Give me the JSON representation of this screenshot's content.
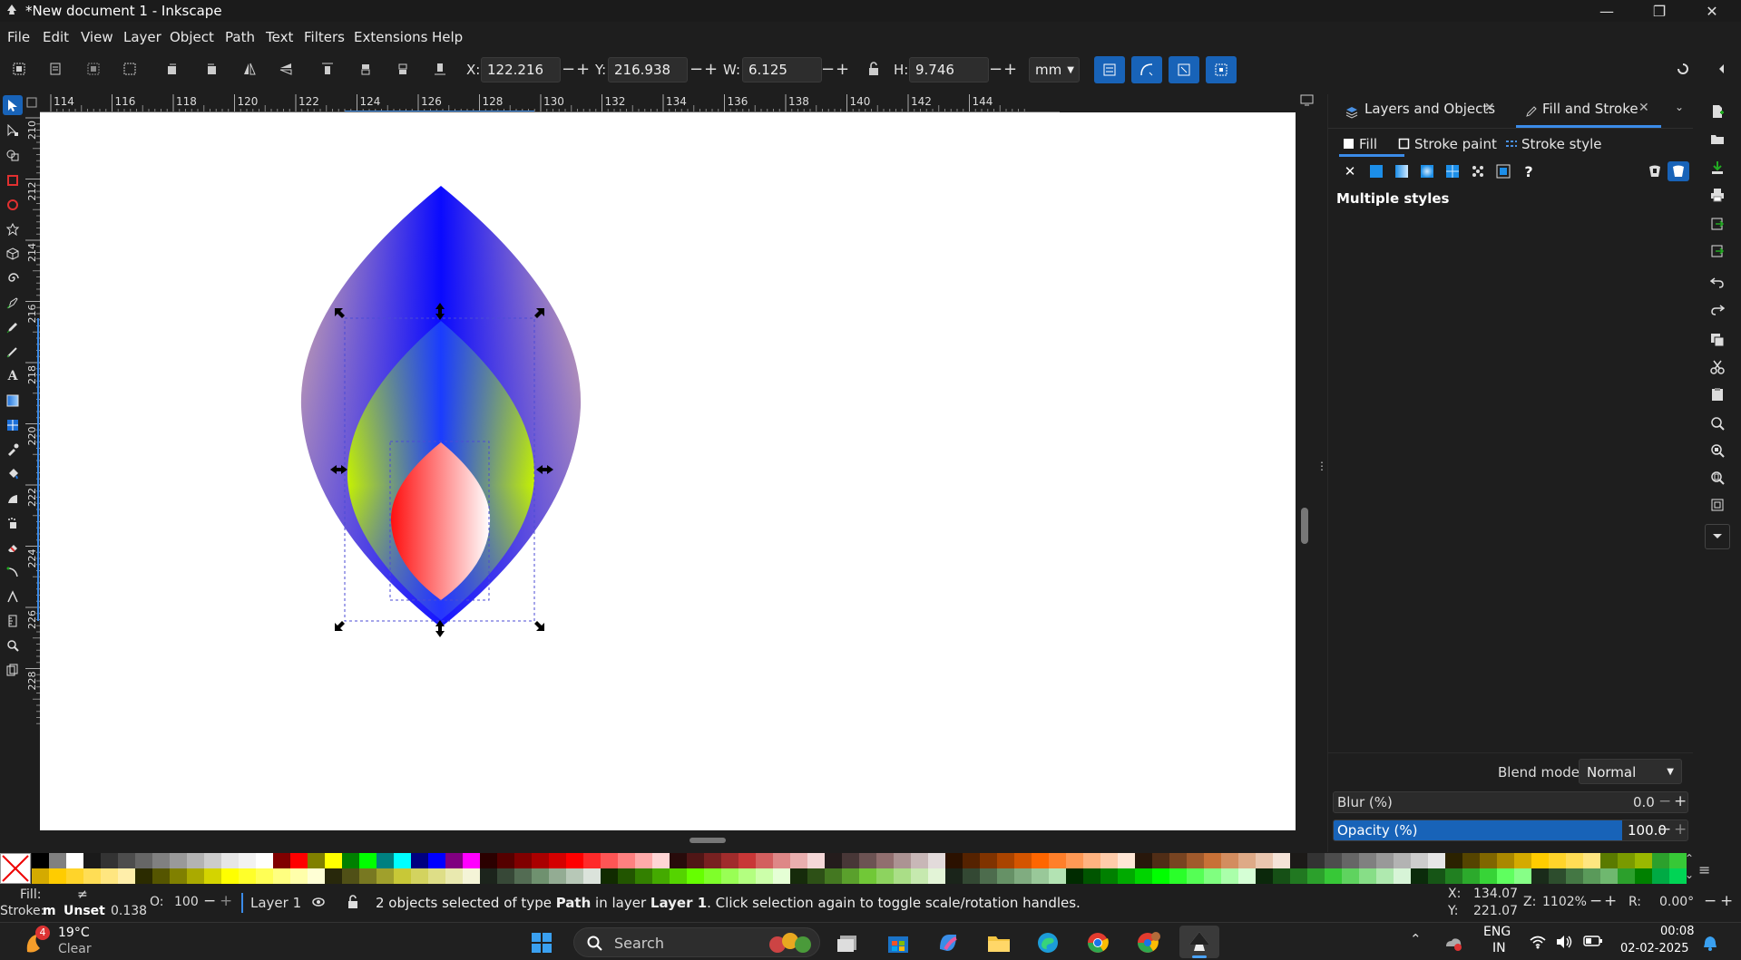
{
  "window": {
    "title": "*New document 1 - Inkscape",
    "minimize": "—",
    "maximize": "❐",
    "close": "✕"
  },
  "menubar": {
    "items": [
      "File",
      "Edit",
      "View",
      "Layer",
      "Object",
      "Path",
      "Text",
      "Filters",
      "Extensions",
      "Help"
    ]
  },
  "controls": {
    "x_label": "X:",
    "x_value": "122.216",
    "y_label": "Y:",
    "y_value": "216.938",
    "w_label": "W:",
    "w_value": "6.125",
    "h_label": "H:",
    "h_value": "9.746",
    "unit": "mm",
    "minus": "−",
    "plus": "+"
  },
  "ruler": {
    "h_ticks": [
      "114",
      "116",
      "118",
      "120",
      "122",
      "124",
      "126",
      "128",
      "130",
      "132",
      "134",
      "136",
      "138",
      "140",
      "142",
      "144"
    ],
    "v_ticks": [
      "210",
      "212",
      "214",
      "216",
      "218",
      "220",
      "222",
      "224",
      "226",
      "228"
    ]
  },
  "dock": {
    "tabs": [
      {
        "label": "Layers and Objects",
        "active": false
      },
      {
        "label": "Fill and Stroke",
        "active": true
      }
    ],
    "subtabs": [
      "Fill",
      "Stroke paint",
      "Stroke style"
    ],
    "unset_glyph": "✕",
    "unknown_glyph": "?",
    "multiple_styles": "Multiple styles",
    "blend_mode_label": "Blend mode:",
    "blend_mode_value": "Normal",
    "blur_label": "Blur (%)",
    "blur_value": "0.0",
    "opacity_label": "Opacity (%)",
    "opacity_value": "100.0",
    "opacity_level": 1.0
  },
  "palette": {
    "colors_top": [
      "#000000",
      "#808080",
      "#ffffff",
      "#1a1a1a",
      "#333333",
      "#4d4d4d",
      "#666666",
      "#808080",
      "#999999",
      "#b3b3b3",
      "#cccccc",
      "#e6e6e6",
      "#f2f2f2",
      "#ffffff",
      "#800000",
      "#ff0000",
      "#808000",
      "#ffff00",
      "#008000",
      "#00ff00",
      "#008080",
      "#00ffff",
      "#000080",
      "#0000ff",
      "#800080",
      "#ff00ff",
      "#2b0000",
      "#550000",
      "#800000",
      "#aa0000",
      "#d40000",
      "#ff0000",
      "#ff2a2a",
      "#ff5555",
      "#ff8080",
      "#ffaaaa",
      "#ffd5d5",
      "#280b0b",
      "#501616",
      "#782121",
      "#a02c2c",
      "#c83737",
      "#d35f5f",
      "#de8787",
      "#e9afaf",
      "#f4d7d7",
      "#241c1c",
      "#483737",
      "#6c5353",
      "#916f6f",
      "#ac9393",
      "#c8b7b7",
      "#e3dbdb",
      "#2b1100",
      "#552200",
      "#803300",
      "#aa4400",
      "#d45500",
      "#ff6600",
      "#ff7f2a",
      "#ff9955",
      "#ffb380",
      "#ffccaa",
      "#ffe6d5",
      "#28170b",
      "#502d16",
      "#784421",
      "#a05a2c",
      "#c87137",
      "#d38d5f",
      "#deaa87",
      "#e9c6af",
      "#f4e3d7",
      "#1c1a18",
      "#333333",
      "#4d4d4d",
      "#666666",
      "#808080",
      "#999999",
      "#b3b3b3",
      "#cccccc",
      "#e6e6e6",
      "#2b2200",
      "#554400",
      "#806600",
      "#aa8800",
      "#d4aa00",
      "#ffcc00",
      "#ffd42a",
      "#ffdd55",
      "#ffe680",
      "#5a7a00",
      "#7a9a00",
      "#9ab800",
      "#2ca02c",
      "#37c837"
    ],
    "colors_bottom": [
      "#d4aa00",
      "#ffcc00",
      "#ffd42a",
      "#ffdd55",
      "#ffe680",
      "#ffeeaa",
      "#2b2b00",
      "#555500",
      "#808000",
      "#aaaa00",
      "#d4d400",
      "#ffff00",
      "#ffff2a",
      "#ffff55",
      "#ffff80",
      "#ffffaa",
      "#ffffd5",
      "#28280b",
      "#505016",
      "#787821",
      "#a0a02c",
      "#c8c837",
      "#d3d35f",
      "#dede87",
      "#e9e9af",
      "#f4f4d7",
      "#1c241c",
      "#374837",
      "#536c53",
      "#6f916f",
      "#93ac93",
      "#b7c8b7",
      "#dbe3db",
      "#112b00",
      "#225500",
      "#338000",
      "#44aa00",
      "#55d400",
      "#66ff00",
      "#7fff2a",
      "#99ff55",
      "#b3ff80",
      "#ccffaa",
      "#e5ffd5",
      "#162b0b",
      "#2d5016",
      "#447821",
      "#5aa02c",
      "#71c837",
      "#8dd35f",
      "#aade87",
      "#c6e9af",
      "#e3f4d7",
      "#1a241a",
      "#334833",
      "#4d6c4d",
      "#669166",
      "#80ac80",
      "#99c899",
      "#b3e3b3",
      "#002b00",
      "#005500",
      "#008000",
      "#00aa00",
      "#00d400",
      "#00ff00",
      "#2aff2a",
      "#55ff55",
      "#80ff80",
      "#aaffaa",
      "#d5ffd5",
      "#0b280b",
      "#165016",
      "#217821",
      "#2ca02c",
      "#37c837",
      "#5fd35f",
      "#87de87",
      "#afe9af",
      "#d7f4d7",
      "#0b2b0b",
      "#165516",
      "#218021",
      "#2caa2c",
      "#37d437",
      "#5fff5f",
      "#87ff87",
      "#1a2b1a",
      "#2d4d2d",
      "#447744",
      "#5a9a5a",
      "#6fb86f",
      "#2ca02c",
      "#008000",
      "#00aa44",
      "#00d455"
    ]
  },
  "status": {
    "fill_label": "Fill:",
    "fill_value": "≠",
    "stroke_label": "Stroke:",
    "stroke_m": "m",
    "stroke_value": "Unset",
    "stroke_width": "0.138",
    "opacity_label": "O:",
    "opacity_value": "100",
    "layer": "Layer 1",
    "message_pre": "2 objects selected of type ",
    "message_type": "Path",
    "message_mid": " in layer ",
    "message_layer": "Layer 1",
    "message_post": ". Click selection again to toggle scale/rotation handles.",
    "cursor_x_label": "X:",
    "cursor_x": "134.07",
    "cursor_y_label": "Y:",
    "cursor_y": "221.07",
    "zoom_label": "Z:",
    "zoom": "1102%",
    "rotation_label": "R:",
    "rotation": "0.00°"
  },
  "taskbar": {
    "weather_temp": "19°C",
    "weather_desc": "Clear",
    "weather_badge": "4",
    "search_placeholder": "Search",
    "lang_line1": "ENG",
    "lang_line2": "IN",
    "time": "00:08",
    "date": "02-02-2025"
  }
}
